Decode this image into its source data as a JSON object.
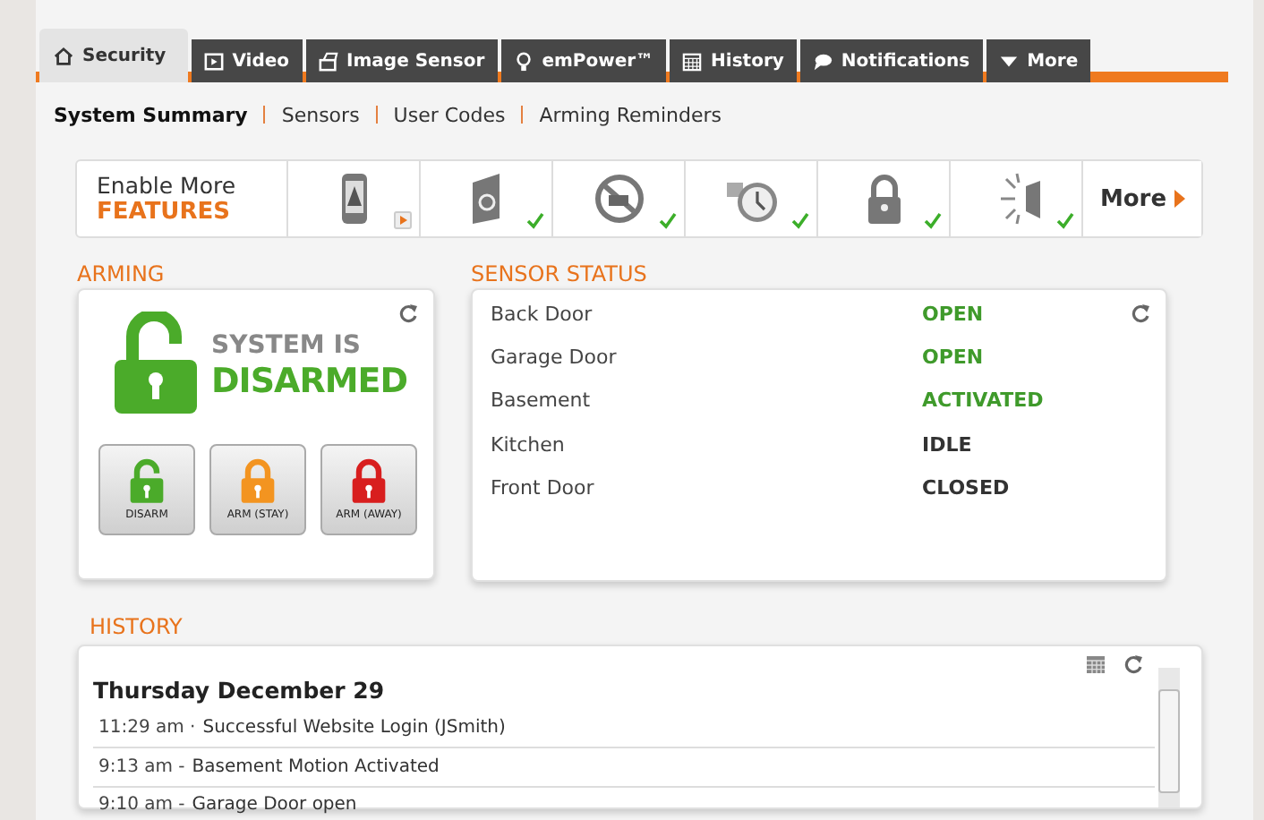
{
  "tabs": [
    {
      "label": "Security",
      "selected": true
    },
    {
      "label": "Video",
      "selected": false
    },
    {
      "label": "Image Sensor",
      "selected": false
    },
    {
      "label": "emPower™",
      "selected": false
    },
    {
      "label": "History",
      "selected": false
    },
    {
      "label": "Notifications",
      "selected": false
    },
    {
      "label": "More",
      "selected": false
    }
  ],
  "subnav": [
    {
      "label": "System Summary",
      "selected": true
    },
    {
      "label": "Sensors",
      "selected": false
    },
    {
      "label": "User Codes",
      "selected": false
    },
    {
      "label": "Arming Reminders",
      "selected": false
    }
  ],
  "features": {
    "title": "Enable More",
    "subtitle": "FEATURES",
    "items": [
      {
        "kind": "promo"
      },
      {
        "kind": "enabled"
      },
      {
        "kind": "enabled"
      },
      {
        "kind": "enabled"
      },
      {
        "kind": "enabled"
      },
      {
        "kind": "enabled"
      }
    ],
    "more": "More"
  },
  "arming": {
    "heading": "ARMING",
    "status_line1": "SYSTEM IS",
    "status_line2": "DISARMED",
    "buttons": [
      {
        "label": "DISARM",
        "color": "#4bab2a"
      },
      {
        "label": "ARM (STAY)",
        "color": "#f39420"
      },
      {
        "label": "ARM (AWAY)",
        "color": "#d81e1e"
      }
    ]
  },
  "sensor_status": {
    "heading": "SENSOR STATUS",
    "sensors": [
      {
        "name": "Back Door",
        "status": "OPEN",
        "color": "#3f9a2b"
      },
      {
        "name": "Garage Door",
        "status": "OPEN",
        "color": "#3f9a2b"
      },
      {
        "name": "Basement",
        "status": "ACTIVATED",
        "color": "#3f9a2b"
      },
      {
        "name": "Kitchen",
        "status": "IDLE",
        "color": "#333333"
      },
      {
        "name": "Front Door",
        "status": "CLOSED",
        "color": "#333333"
      }
    ]
  },
  "history": {
    "heading": "HISTORY",
    "date": "Thursday December 29",
    "events": [
      {
        "time": "11:29 am ·",
        "text": "Successful Website Login (JSmith)"
      },
      {
        "time": "9:13 am -",
        "text": "Basement Motion Activated"
      },
      {
        "time": "9:10 am -",
        "text": "Garage Door open"
      }
    ]
  }
}
